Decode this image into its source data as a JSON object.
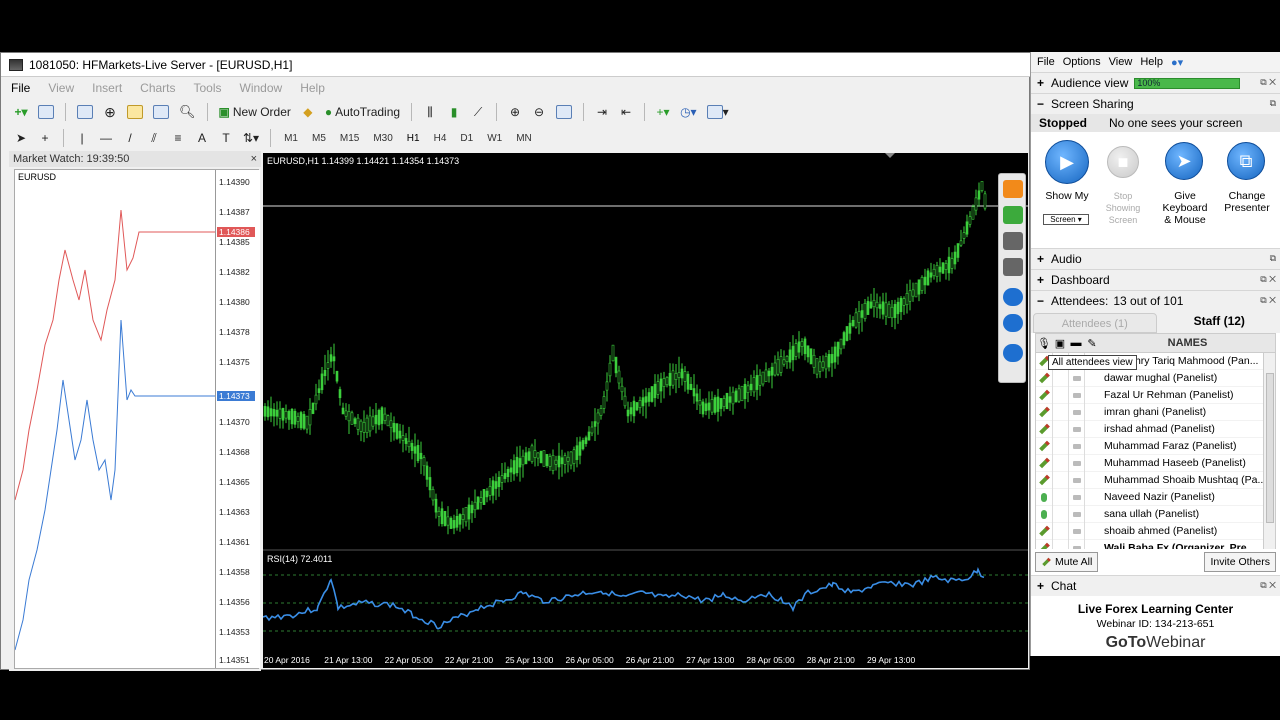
{
  "mt4": {
    "title": "1081050: HFMarkets-Live Server - [EURUSD,H1]",
    "menu": [
      "File",
      "View",
      "Insert",
      "Charts",
      "Tools",
      "Window",
      "Help"
    ],
    "toolbar": {
      "new_order": "New Order",
      "autotrading": "AutoTrading"
    },
    "timeframes": [
      "M1",
      "M5",
      "M15",
      "M30",
      "H1",
      "H4",
      "D1",
      "W1",
      "MN"
    ],
    "active_tf": "H1",
    "tool_letters": {
      "text": "A",
      "label": "T"
    }
  },
  "market_watch": {
    "title": "Market Watch: 19:39:50",
    "close": "×",
    "symbol": "EURUSD",
    "price_ticks": [
      "1.14390",
      "1.14387",
      "1.14385",
      "1.14382",
      "1.14380",
      "1.14378",
      "1.14375",
      "1.14370",
      "1.14368",
      "1.14365",
      "1.14363",
      "1.14361",
      "1.14358",
      "1.14356",
      "1.14353",
      "1.14351"
    ],
    "ask_tag": "1.14386",
    "bid_tag": "1.14373",
    "ask_color": "#e05858",
    "bid_color": "#3b7bd4"
  },
  "chart": {
    "label": "EURUSD,H1  1.14399 1.14421 1.14354 1.14373",
    "rsi_label": "RSI(14) 72.4011",
    "x_ticks": [
      "20 Apr 2016",
      "21 Apr 13:00",
      "22 Apr 05:00",
      "22 Apr 21:00",
      "25 Apr 13:00",
      "26 Apr 05:00",
      "26 Apr 21:00",
      "27 Apr 13:00",
      "28 Apr 05:00",
      "28 Apr 21:00",
      "29 Apr 13:00"
    ],
    "candle_color": "#3ccf3c",
    "rsi_color": "#3a8ee6"
  },
  "gtw": {
    "menu": [
      "File",
      "Options",
      "View",
      "Help"
    ],
    "audience_view": "Audience view",
    "audience_level": "100%",
    "screen_sharing": "Screen Sharing",
    "status": "Stopped",
    "status_msg": "No one sees your screen",
    "show_my": "Show My",
    "show_sel": "Screen ▾",
    "stop_showing": "Stop Showing Screen",
    "give_kb": "Give Keyboard & Mouse",
    "change_presenter": "Change Presenter",
    "audio": "Audio",
    "dashboard": "Dashboard",
    "attendees_title": "Attendees:",
    "attendees_count": "13 out of 101",
    "tab_attendees": "Attendees (1)",
    "tab_staff": "Staff (12)",
    "names_header": "NAMES",
    "tooltip": "All attendees view",
    "staff": [
      "Chaudhry Tariq Mahmood (Pan...",
      "dawar mughal (Panelist)",
      "Fazal  Ur Rehman (Panelist)",
      "imran ghani (Panelist)",
      "irshad ahmad (Panelist)",
      "Muhammad  Faraz (Panelist)",
      "Muhammad Haseeb (Panelist)",
      "Muhammad Shoaib Mushtaq (Pa...",
      "Naveed Nazir (Panelist)",
      "sana ullah (Panelist)",
      "shoaib ahmed (Panelist)",
      "Wali Baba  Fx (Organizer, Pre..."
    ],
    "mute_all": "Mute All",
    "invite_others": "Invite Others",
    "chat": "Chat",
    "org": "Live Forex Learning Center",
    "webinar_id": "Webinar ID: 134-213-651",
    "brand_bold": "GoTo",
    "brand_rest": "Webinar"
  }
}
